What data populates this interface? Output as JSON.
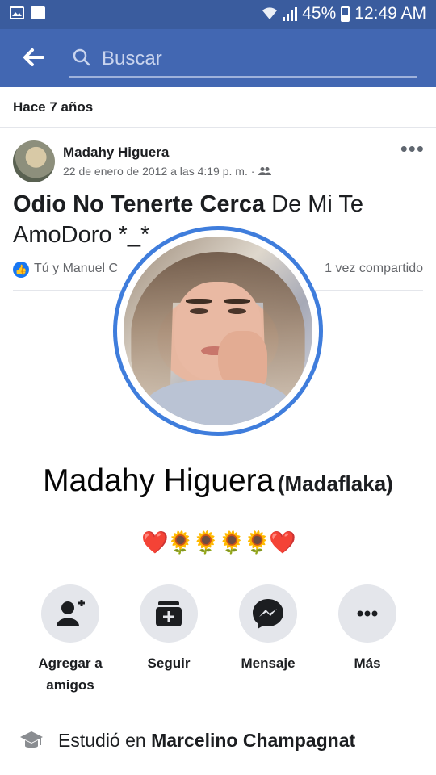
{
  "status_bar": {
    "battery": "45%",
    "time": "12:49 AM",
    "icons": [
      "image-notification-icon",
      "message-notification-icon",
      "wifi-icon",
      "signal-icon",
      "battery-icon"
    ]
  },
  "search": {
    "placeholder": "Buscar"
  },
  "feed": {
    "section_label": "Hace 7 años",
    "post": {
      "author": "Madahy Higuera",
      "date": "22 de enero de 2012 a las 4:19 p. m. ·",
      "text_bold": "Odio No Tenerte Cerca",
      "text_regular": " De Mi Te AmoDoro *_*",
      "reactions": "Tú y Manuel C",
      "shares": "1 vez compartido"
    }
  },
  "profile": {
    "name": "Madahy Higuera",
    "nickname": "(Madaflaka)",
    "bio": {
      "heart_left": "❤️",
      "flowers": "🌻🌻🌻🌻",
      "heart_right": "❤️"
    },
    "actions": [
      {
        "label_line1": "Agregar a",
        "label_line2": "amigos"
      },
      {
        "label_line1": "Seguir",
        "label_line2": ""
      },
      {
        "label_line1": "Mensaje",
        "label_line2": ""
      },
      {
        "label_line1": "Más",
        "label_line2": ""
      }
    ],
    "info": {
      "prefix": "Estudió en ",
      "school": "Marcelino Champagnat"
    }
  },
  "colors": {
    "status_bar": "#3a5c9e",
    "header": "#4267b2",
    "ring": "#3f7ddc",
    "button_bg": "#e4e6eb"
  }
}
